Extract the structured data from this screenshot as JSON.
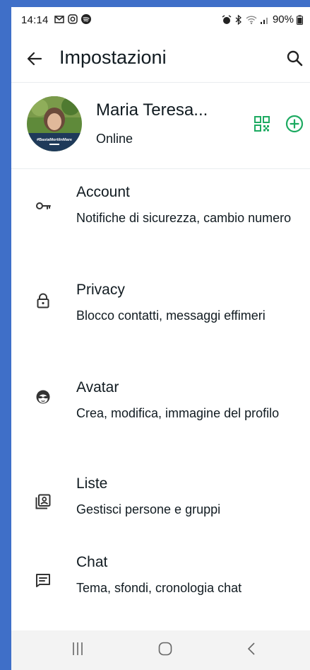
{
  "status_bar": {
    "time": "14:14",
    "battery": "90%"
  },
  "app_bar": {
    "title": "Impostazioni"
  },
  "profile": {
    "name": "Maria Teresa...",
    "status": "Online",
    "avatar_caption": "#BastaMortiInMare"
  },
  "settings": [
    {
      "title": "Account",
      "subtitle": "Notifiche di sicurezza, cambio numero",
      "icon": "key-icon"
    },
    {
      "title": "Privacy",
      "subtitle": "Blocco contatti, messaggi effimeri",
      "icon": "lock-icon"
    },
    {
      "title": "Avatar",
      "subtitle": "Crea, modifica, immagine del profilo",
      "icon": "avatar-face-icon"
    },
    {
      "title": "Liste",
      "subtitle": "Gestisci persone e gruppi",
      "icon": "contact-list-icon"
    },
    {
      "title": "Chat",
      "subtitle": "Tema, sfondi, cronologia chat",
      "icon": "chat-icon"
    }
  ],
  "colors": {
    "accent": "#1daa61",
    "frame": "#3f6fc8",
    "text": "#111b21"
  }
}
